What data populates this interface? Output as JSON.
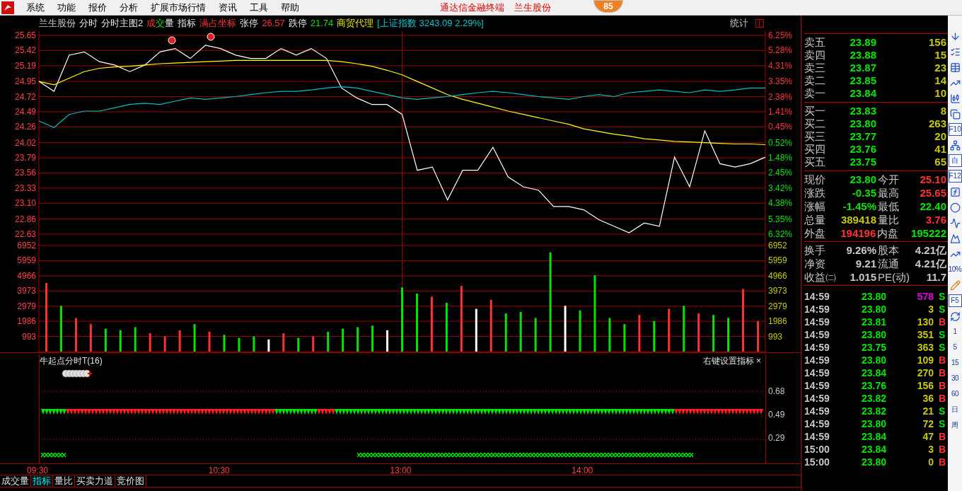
{
  "menu": {
    "items": [
      "系统",
      "功能",
      "报价",
      "分析",
      "扩展市场行情",
      "资讯",
      "工具",
      "帮助"
    ],
    "title": "通达信金融终端",
    "stock": "兰生股份",
    "badge": "85"
  },
  "header": [
    {
      "text": "兰生股份",
      "kind": "name"
    },
    {
      "text": "分时",
      "kind": "plain"
    },
    {
      "text": "分时主图2",
      "kind": "plain"
    },
    {
      "text": "成交量",
      "kind": "tricolor"
    },
    {
      "text": "指标",
      "kind": "plain"
    },
    {
      "text": "满占坐标",
      "kind": "alert"
    },
    {
      "text": "张停",
      "kind": "plain"
    },
    {
      "text": "26.57",
      "kind": "up"
    },
    {
      "text": "跌停",
      "kind": "plain"
    },
    {
      "text": "21.74",
      "kind": "down"
    },
    {
      "text": "商贸代理",
      "kind": "sector"
    },
    {
      "text": "[上证指数 3243.09 2.29%]",
      "kind": "index"
    }
  ],
  "stats_link": "统计",
  "price_chart": {
    "chart_data": {
      "type": "line",
      "grid": true,
      "ylim": [
        22.63,
        25.65
      ],
      "yticks": [
        {
          "value": 25.65,
          "label": "25.65"
        },
        {
          "value": 25.42,
          "label": "25.42"
        },
        {
          "value": 25.19,
          "label": "25.19"
        },
        {
          "value": 24.95,
          "label": "24.95"
        },
        {
          "value": 24.72,
          "label": "24.72"
        },
        {
          "value": 24.49,
          "label": "24.49"
        },
        {
          "value": 24.26,
          "label": "24.26"
        },
        {
          "value": 24.02,
          "label": "24.02"
        },
        {
          "value": 23.79,
          "label": "23.79"
        },
        {
          "value": 23.56,
          "label": "23.56"
        },
        {
          "value": 23.33,
          "label": "23.33"
        },
        {
          "value": 23.1,
          "label": "23.10"
        },
        {
          "value": 22.86,
          "label": "22.86"
        },
        {
          "value": 22.63,
          "label": "22.63"
        }
      ],
      "series": [
        {
          "color": "#ffffff",
          "values": [
            24.95,
            24.8,
            25.35,
            25.4,
            25.25,
            25.2,
            25.1,
            25.2,
            25.4,
            25.45,
            25.3,
            25.5,
            25.45,
            25.35,
            25.3,
            25.3,
            25.45,
            25.35,
            25.45,
            25.3,
            24.85,
            24.7,
            24.6,
            24.6,
            24.45,
            23.6,
            23.65,
            23.15,
            23.6,
            23.6,
            23.95,
            23.5,
            23.35,
            23.3,
            23.05,
            23.05,
            23.0,
            22.85,
            22.75,
            22.65,
            22.8,
            22.75,
            23.8,
            23.35,
            24.2,
            23.7,
            23.65,
            23.7,
            23.8
          ]
        },
        {
          "color": "#ffff00",
          "values": [
            24.95,
            24.9,
            25.0,
            25.1,
            25.15,
            25.17,
            25.18,
            25.2,
            25.22,
            25.23,
            25.24,
            25.25,
            25.26,
            25.27,
            25.27,
            25.27,
            25.27,
            25.27,
            25.27,
            25.27,
            25.25,
            25.22,
            25.18,
            25.12,
            25.05,
            24.95,
            24.85,
            24.75,
            24.68,
            24.62,
            24.56,
            24.5,
            24.45,
            24.4,
            24.35,
            24.3,
            24.23,
            24.19,
            24.15,
            24.12,
            24.08,
            24.06,
            24.04,
            24.03,
            24.02,
            24.01,
            24.0,
            24.0,
            23.99
          ]
        },
        {
          "color": "#00c0c0",
          "values": [
            24.35,
            24.25,
            24.45,
            24.5,
            24.5,
            24.55,
            24.6,
            24.62,
            24.6,
            24.65,
            24.7,
            24.68,
            24.7,
            24.72,
            24.75,
            24.78,
            24.8,
            24.8,
            24.82,
            24.85,
            24.87,
            24.85,
            24.8,
            24.75,
            24.7,
            24.68,
            24.7,
            24.72,
            24.75,
            24.78,
            24.8,
            24.78,
            24.75,
            24.72,
            24.7,
            24.68,
            24.72,
            24.75,
            24.72,
            24.78,
            24.8,
            24.82,
            24.8,
            24.78,
            24.82,
            24.8,
            24.82,
            24.85,
            24.85
          ]
        }
      ]
    },
    "percent_labels": [
      {
        "label": "6.25%",
        "color": "#ff3232"
      },
      {
        "label": "5.28%",
        "color": "#ff3232"
      },
      {
        "label": "4.31%",
        "color": "#ff3232"
      },
      {
        "label": "3.35%",
        "color": "#ff3232"
      },
      {
        "label": "2.38%",
        "color": "#ff3232"
      },
      {
        "label": "1.41%",
        "color": "#ff3232"
      },
      {
        "label": "0.45%",
        "color": "#ff3232"
      },
      {
        "label": "0.52%",
        "color": "#00e600"
      },
      {
        "label": "1.48%",
        "color": "#00e600"
      },
      {
        "label": "2.45%",
        "color": "#00e600"
      },
      {
        "label": "3.42%",
        "color": "#00e600"
      },
      {
        "label": "4.38%",
        "color": "#00e600"
      },
      {
        "label": "5.35%",
        "color": "#00e600"
      },
      {
        "label": "6.32%",
        "color": "#00e600"
      }
    ]
  },
  "volume_chart": {
    "chart_data": {
      "type": "bar",
      "grid": true,
      "ylim": [
        0,
        6952
      ],
      "yticks": [
        {
          "value": 6952,
          "label": "6952"
        },
        {
          "value": 5959,
          "label": "5959"
        },
        {
          "value": 4966,
          "label": "4966"
        },
        {
          "value": 3973,
          "label": "3973"
        },
        {
          "value": 2979,
          "label": "2979"
        },
        {
          "value": 1986,
          "label": "1986"
        },
        {
          "value": 993,
          "label": "993"
        }
      ],
      "values": [
        4500,
        3000,
        2200,
        1800,
        1500,
        1400,
        1600,
        1200,
        1000,
        1400,
        1800,
        1300,
        1100,
        900,
        1000,
        800,
        1200,
        900,
        1000,
        1300,
        1500,
        1600,
        1700,
        1400,
        4200,
        3800,
        3600,
        3200,
        4300,
        2800,
        3400,
        2500,
        2600,
        2200,
        6500,
        3000,
        2700,
        5000,
        2200,
        1800,
        2400,
        2000,
        2800,
        3000,
        2500,
        2400,
        2200,
        4100,
        2000
      ]
    },
    "right_axis_labels": [
      "6952",
      "5959",
      "4966",
      "3973",
      "2979",
      "1986",
      "993"
    ]
  },
  "indicator": {
    "title": "牛起点分时T(16)",
    "settings": "右键设置指标",
    "close": "×",
    "axis_labels": [
      "0.68",
      "0.49",
      "0.29"
    ]
  },
  "time_axis": [
    "09:30",
    "10:30",
    "13:00",
    "14:00"
  ],
  "bottom_tabs": [
    {
      "label": "成交量",
      "selected": false
    },
    {
      "label": "指标",
      "selected": true
    },
    {
      "label": "量比",
      "selected": false
    },
    {
      "label": "买卖力道",
      "selected": false
    },
    {
      "label": "竞价图",
      "selected": false
    }
  ],
  "asks": [
    {
      "label": "卖五",
      "price": "23.89",
      "volume": "156"
    },
    {
      "label": "卖四",
      "price": "23.88",
      "volume": "15"
    },
    {
      "label": "卖三",
      "price": "23.87",
      "volume": "23"
    },
    {
      "label": "卖二",
      "price": "23.85",
      "volume": "14"
    },
    {
      "label": "卖一",
      "price": "23.84",
      "volume": "10"
    }
  ],
  "bids": [
    {
      "label": "买一",
      "price": "23.83",
      "volume": "8"
    },
    {
      "label": "买二",
      "price": "23.80",
      "volume": "263"
    },
    {
      "label": "买三",
      "price": "23.77",
      "volume": "20"
    },
    {
      "label": "买四",
      "price": "23.76",
      "volume": "41"
    },
    {
      "label": "买五",
      "price": "23.75",
      "volume": "65"
    }
  ],
  "stats": [
    {
      "left": {
        "label": "现价",
        "value": "23.80",
        "color": "#00e600"
      },
      "right": {
        "label": "今开",
        "value": "25.10",
        "color": "#ff3232"
      }
    },
    {
      "left": {
        "label": "涨跌",
        "value": "-0.35",
        "color": "#00e600"
      },
      "right": {
        "label": "最高",
        "value": "25.65",
        "color": "#ff3232"
      }
    },
    {
      "left": {
        "label": "涨幅",
        "value": "-1.45%",
        "color": "#00e600"
      },
      "right": {
        "label": "最低",
        "value": "22.40",
        "color": "#00e600"
      }
    },
    {
      "left": {
        "label": "总量",
        "value": "389418",
        "color": "#c8c800"
      },
      "right": {
        "label": "量比",
        "value": "3.76",
        "color": "#ff3232"
      }
    },
    {
      "left": {
        "label": "外盘",
        "value": "194196",
        "color": "#ff3232"
      },
      "right": {
        "label": "内盘",
        "value": "195222",
        "color": "#00e600"
      }
    }
  ],
  "fundamentals": [
    {
      "left": {
        "label": "换手",
        "value": "9.26%"
      },
      "right": {
        "label": "股本",
        "value": "4.21亿"
      }
    },
    {
      "left": {
        "label": "净资",
        "value": "9.21"
      },
      "right": {
        "label": "流通",
        "value": "4.21亿"
      }
    },
    {
      "left": {
        "label": "收益㈡",
        "value": "1.015"
      },
      "right": {
        "label": "PE(动)",
        "value": "11.7"
      }
    }
  ],
  "trades": [
    {
      "time": "14:59",
      "price": "23.80",
      "volume": "578",
      "side": "S",
      "kind": "sell",
      "large": true
    },
    {
      "time": "14:59",
      "price": "23.80",
      "volume": "3",
      "side": "S",
      "kind": "sell",
      "large": false
    },
    {
      "time": "14:59",
      "price": "23.81",
      "volume": "130",
      "side": "B",
      "kind": "buy",
      "large": false
    },
    {
      "time": "14:59",
      "price": "23.80",
      "volume": "351",
      "side": "S",
      "kind": "sell",
      "large": false
    },
    {
      "time": "14:59",
      "price": "23.75",
      "volume": "363",
      "side": "S",
      "kind": "sell",
      "large": false
    },
    {
      "time": "14:59",
      "price": "23.80",
      "volume": "109",
      "side": "B",
      "kind": "buy",
      "large": false
    },
    {
      "time": "14:59",
      "price": "23.84",
      "volume": "270",
      "side": "B",
      "kind": "buy",
      "large": false
    },
    {
      "time": "14:59",
      "price": "23.76",
      "volume": "156",
      "side": "B",
      "kind": "buy",
      "large": false
    },
    {
      "time": "14:59",
      "price": "23.82",
      "volume": "36",
      "side": "B",
      "kind": "buy",
      "large": false
    },
    {
      "time": "14:59",
      "price": "23.82",
      "volume": "21",
      "side": "S",
      "kind": "sell",
      "large": false
    },
    {
      "time": "14:59",
      "price": "23.80",
      "volume": "72",
      "side": "S",
      "kind": "sell",
      "large": false
    },
    {
      "time": "14:59",
      "price": "23.84",
      "volume": "47",
      "side": "B",
      "kind": "buy",
      "large": false
    },
    {
      "time": "15:00",
      "price": "23.84",
      "volume": "3",
      "side": "B",
      "kind": "buy",
      "large": false
    },
    {
      "time": "15:00",
      "price": "23.80",
      "volume": "0",
      "side": "B",
      "kind": "buy",
      "large": false
    }
  ],
  "toolbar": [
    {
      "kind": "arrow"
    },
    {
      "kind": "list"
    },
    {
      "kind": "table"
    },
    {
      "kind": "line"
    },
    {
      "kind": "candles"
    },
    {
      "kind": "pages"
    },
    {
      "kind": "boxed",
      "label": "F10"
    },
    {
      "kind": "tree"
    },
    {
      "kind": "boxed",
      "label": "自"
    },
    {
      "kind": "boxed",
      "label": "F12"
    },
    {
      "kind": "function"
    },
    {
      "kind": "circle"
    },
    {
      "kind": "wave"
    },
    {
      "kind": "mountain"
    },
    {
      "kind": "line"
    },
    {
      "kind": "text",
      "label": "10%"
    },
    {
      "kind": "pencil"
    },
    {
      "kind": "boxed",
      "label": "F5"
    },
    {
      "kind": "refresh"
    },
    {
      "kind": "text",
      "label": "1"
    },
    {
      "kind": "text",
      "label": "5"
    },
    {
      "kind": "text",
      "label": "15"
    },
    {
      "kind": "text",
      "label": "30"
    },
    {
      "kind": "text",
      "label": "60"
    },
    {
      "kind": "text",
      "label": "日"
    },
    {
      "kind": "text",
      "label": "周"
    }
  ]
}
